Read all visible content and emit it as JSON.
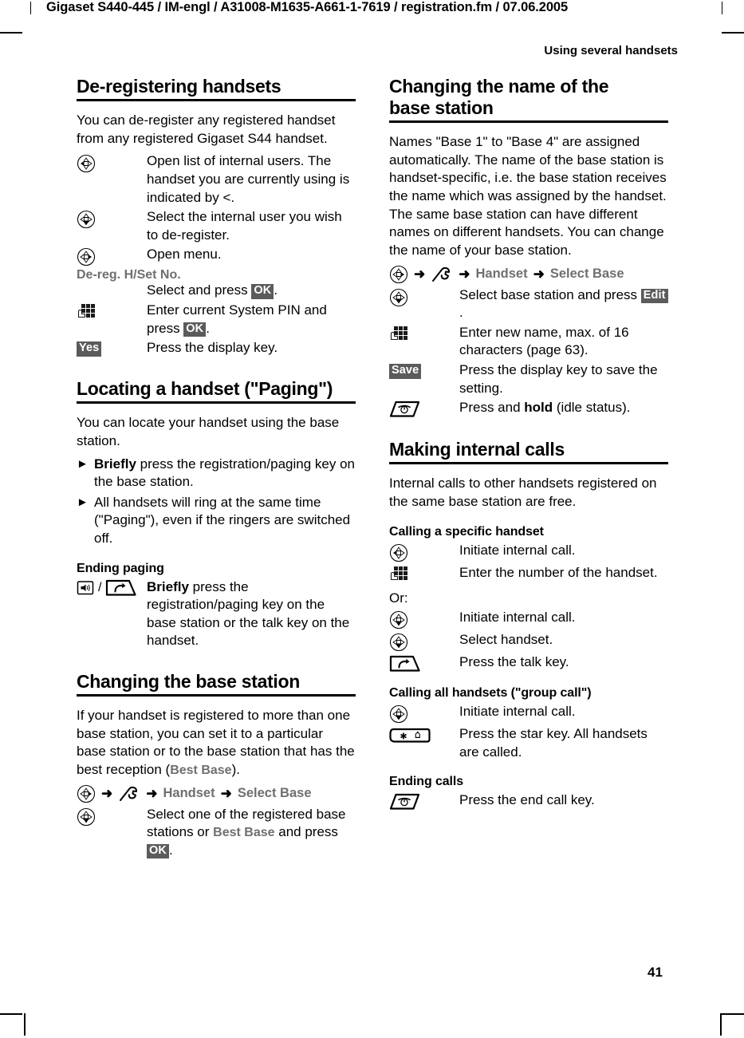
{
  "header": {
    "file_line": "Gigaset S440-445 / IM-engl / A31008-M1635-A661-1-7619 / registration.fm / 07.06.2005",
    "chapter": "Using several handsets"
  },
  "footer": {
    "page_number": "41"
  },
  "colors": {
    "badge_bg": "#5b5b5b",
    "badge_text": "#ffffff",
    "menu_grey": "#6f6f6f",
    "rule": "#000000"
  },
  "left_column": {
    "section1": {
      "title": "De-registering handsets",
      "intro": "You can de-register any registered handset from any registered Gigaset S44 handset.",
      "steps": [
        {
          "icon": "control-key-left-icon",
          "text": "Open list of internal users. The handset you are currently using is indicated by <."
        },
        {
          "icon": "control-key-down-icon",
          "text": "Select the internal user you wish to de-register."
        },
        {
          "icon": "control-key-right-icon",
          "text": "Open menu."
        }
      ],
      "menu_item": "De-reg. H/Set No.",
      "step_select": {
        "pre": "Select and press ",
        "key": "OK",
        "post": "."
      },
      "step_pin": {
        "icon": "keypad-icon",
        "pre": "Enter current System PIN and press ",
        "key": "OK",
        "post": "."
      },
      "step_yes": {
        "key": "Yes",
        "text": "Press the display key."
      }
    },
    "section2": {
      "title": "Locating a handset (\"Paging\")",
      "intro": "You can locate your handset using the base station.",
      "bullets": [
        {
          "bold": "Briefly",
          "text": " press the registration/paging key on the base station."
        },
        {
          "bold": "",
          "text": "All handsets will ring at the same time (\"Paging\"), even if the ringers are switched off."
        }
      ],
      "sub_title": "Ending paging",
      "ending_step": {
        "icon_a": "paging-key-icon",
        "separator": "/",
        "icon_b": "talk-key-icon",
        "bold": "Briefly",
        "text": " press the registration/paging key on the base station or the talk key on the handset."
      }
    },
    "section3": {
      "title": "Changing the base station",
      "intro_pre": "If your handset is registered to more than one base station, you can set it to a particular base station or to the base station that has the best reception (",
      "intro_grey": "Best Base",
      "intro_post": ").",
      "menu_path": {
        "icon": "control-key-right-icon",
        "wrench": "settings-wrench-icon",
        "arrow": "➜",
        "item1": "Handset",
        "item2": "Select Base"
      },
      "step": {
        "icon": "control-key-down-icon",
        "pre": "Select one of the registered base stations or ",
        "grey": "Best Base",
        "mid": " and press ",
        "key": "OK",
        "post": "."
      }
    }
  },
  "right_column": {
    "section1": {
      "title_line1": "Changing the name of the",
      "title_line2": "base station",
      "intro": "Names \"Base 1\" to \"Base 4\" are assigned automatically. The name of the base station is handset-specific, i.e. the base station receives the name which was assigned by the handset. The same base station can have different names on different handsets. You can change the name of your base station.",
      "menu_path": {
        "icon": "control-key-right-icon",
        "wrench": "settings-wrench-icon",
        "arrow": "➜",
        "item1": "Handset",
        "item2": "Select Base"
      },
      "steps": [
        {
          "icon": "control-key-down-icon",
          "pre": "Select base station and press ",
          "key": "Edit",
          "post": "."
        },
        {
          "icon": "keypad-icon",
          "pre": "Enter new name, max. of 16 characters (page 63).",
          "key": "",
          "post": ""
        },
        {
          "icon": "",
          "key": "Save",
          "pre": "Press the display key to save the setting.",
          "post": ""
        },
        {
          "icon": "end-call-key-icon",
          "pre": "Press and ",
          "bold": "hold",
          "post": " (idle status)."
        }
      ]
    },
    "section2": {
      "title": "Making internal calls",
      "intro": "Internal calls to other handsets registered on the same base station are free.",
      "sub1_title": "Calling a specific handset",
      "sub1_steps": [
        {
          "icon": "control-key-left-icon",
          "text": "Initiate internal call."
        },
        {
          "icon": "keypad-icon",
          "text": "Enter the number of the handset."
        }
      ],
      "or_label": "Or:",
      "sub1_steps_alt": [
        {
          "icon": "control-key-down-icon",
          "text": "Initiate internal call."
        },
        {
          "icon": "control-key-down-icon",
          "text": "Select handset."
        },
        {
          "icon": "talk-key-icon",
          "text": "Press the talk key."
        }
      ],
      "sub2_title": "Calling all handsets (\"group call\")",
      "sub2_steps": [
        {
          "icon": "control-key-down-icon",
          "text": "Initiate internal call."
        },
        {
          "icon": "star-key-icon",
          "text": "Press the star key. All handsets are called."
        }
      ],
      "sub3_title": "Ending calls",
      "sub3_steps": [
        {
          "icon": "end-call-key-icon",
          "text": "Press the end call key."
        }
      ]
    }
  }
}
